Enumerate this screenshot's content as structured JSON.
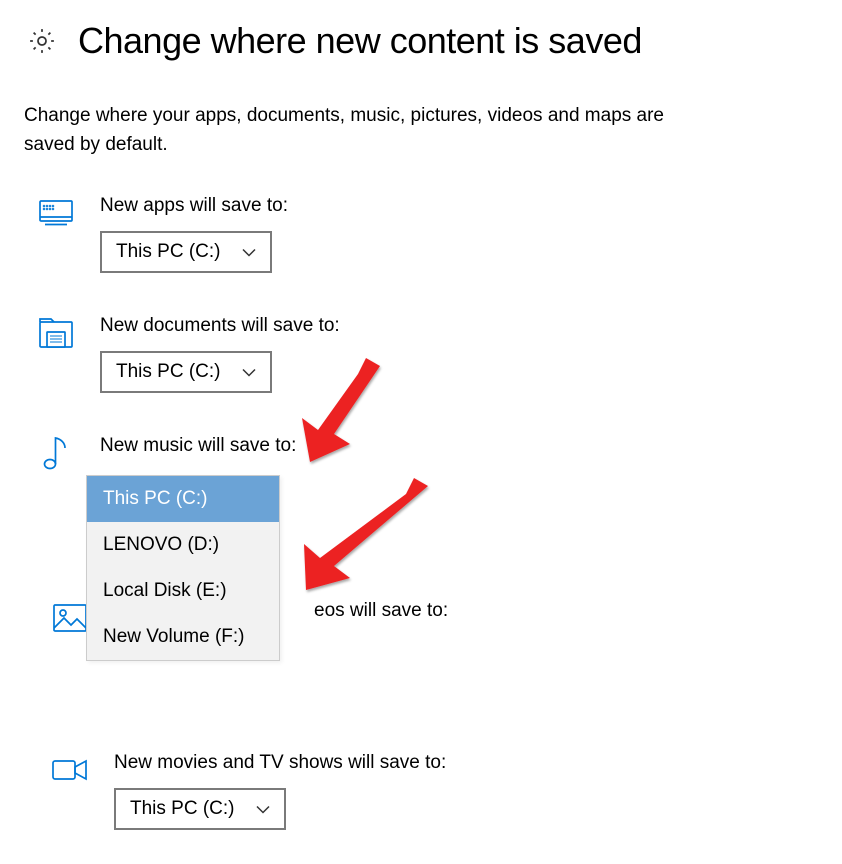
{
  "page": {
    "title": "Change where new content is saved",
    "description": "Change where your apps, documents, music, pictures, videos and maps are saved by default."
  },
  "settings": {
    "apps": {
      "label": "New apps will save to:",
      "value": "This PC (C:)"
    },
    "documents": {
      "label": "New documents will save to:",
      "value": "This PC (C:)"
    },
    "music": {
      "label": "New music will save to:",
      "value": "This PC (C:)",
      "options": [
        "This PC (C:)",
        "LENOVO (D:)",
        "Local Disk (E:)",
        "New Volume (F:)"
      ],
      "selected_index": 0,
      "open": true
    },
    "photos_videos": {
      "label": "eos will save to:"
    },
    "movies_tv": {
      "label": "New movies and TV shows will save to:",
      "value": "This PC (C:)"
    }
  },
  "colors": {
    "icon_blue": "#0078d7",
    "arrow_red": "#ec2024"
  }
}
